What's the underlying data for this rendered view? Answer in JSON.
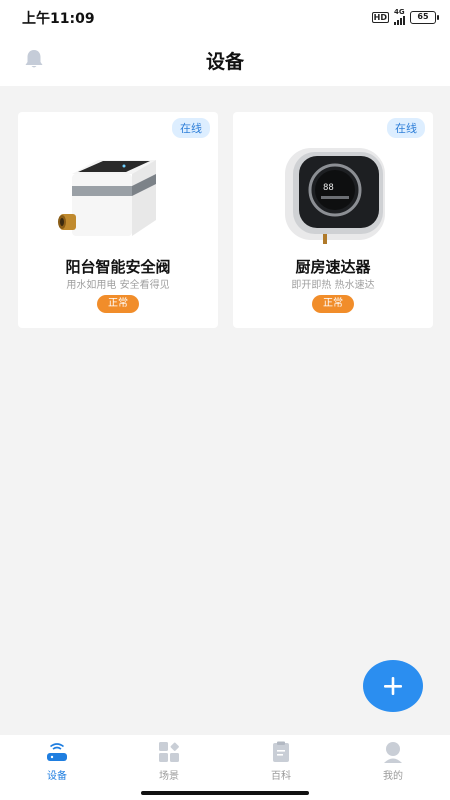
{
  "status_bar": {
    "time": "上午11:09",
    "hd": "HD",
    "network": "4G",
    "battery": "65"
  },
  "header": {
    "title": "设备",
    "left_icon": "bell-icon"
  },
  "devices": [
    {
      "status_tag": "在线",
      "name": "阳台智能安全阀",
      "description": "用水如用电 安全看得见",
      "state": "正常",
      "image": "smart-valve"
    },
    {
      "status_tag": "在线",
      "name": "厨房速达器",
      "description": "即开即热 热水速达",
      "state": "正常",
      "image": "instant-water-heater"
    }
  ],
  "fab": {
    "icon": "plus-icon"
  },
  "tabs": [
    {
      "label": "设备",
      "icon": "router-icon",
      "active": true
    },
    {
      "label": "场景",
      "icon": "grid-icon",
      "active": false
    },
    {
      "label": "百科",
      "icon": "document-icon",
      "active": false
    },
    {
      "label": "我的",
      "icon": "user-icon",
      "active": false
    }
  ],
  "colors": {
    "accent": "#1f7ee0",
    "fab": "#2b8ef0",
    "badge_orange": "#f18d2a",
    "online_bg": "#ddeeff",
    "online_text": "#2f7fd8",
    "page_bg": "#f3f3f3"
  }
}
